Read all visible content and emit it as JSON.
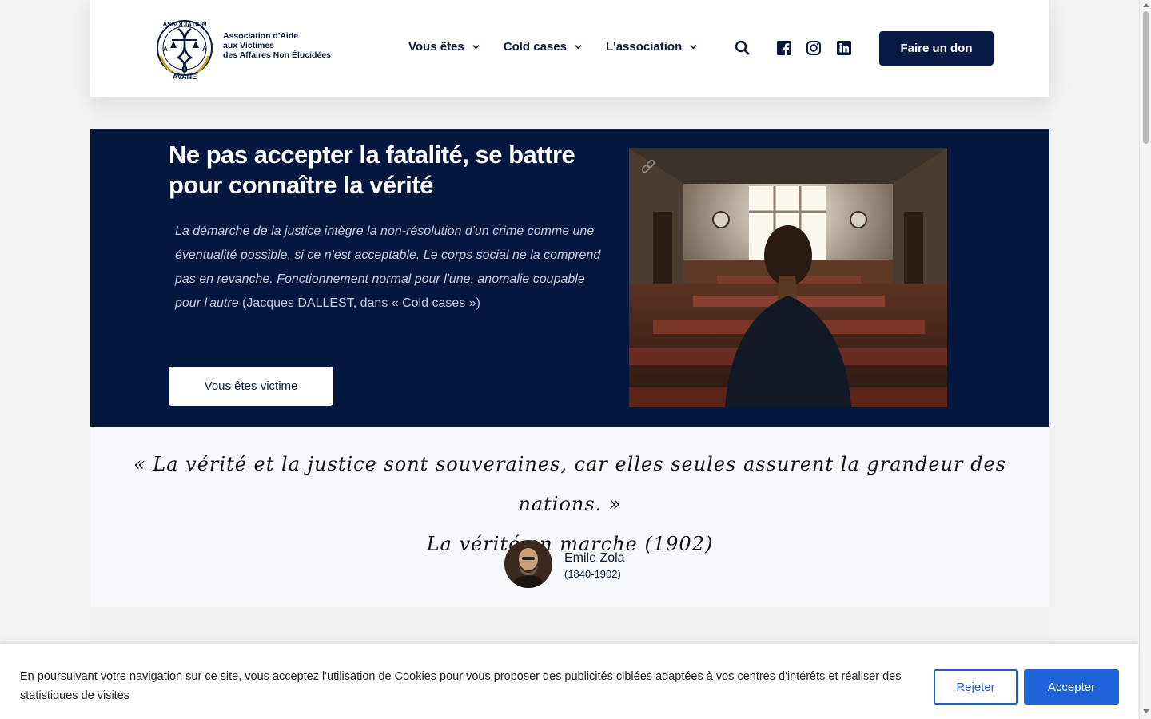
{
  "header": {
    "logo_ring_text": "ASSOCIATION",
    "logo_bottom_text": "AVANE",
    "logo_side_letter": "A",
    "logo_text_lines": [
      "Association d'Aide",
      "aux Victimes",
      "des Affaires Non Élucidées"
    ],
    "nav": [
      {
        "label": "Vous êtes",
        "icon": "chevron-down-icon"
      },
      {
        "label": "Cold cases",
        "icon": "chevron-down-icon"
      },
      {
        "label": "L'association",
        "icon": "chevron-down-icon"
      }
    ],
    "icons": [
      "search-icon",
      "facebook-icon",
      "instagram-icon",
      "linkedin-icon"
    ],
    "donate_label": "Faire un don"
  },
  "hero": {
    "title": "Ne pas accepter la fatalité, se battre pour connaître la vérité",
    "quote_italic": "La démarche de la justice intègre la non-résolution d'un crime comme une éventualité possible, si ce n'est acceptable. Le corps social ne la comprend pas en revanche. Fonctionnement normal pour l'une, anomalie coupable pour l'autre",
    "quote_source": " (Jacques DALLEST, dans « Cold cases »)",
    "cta_label": "Vous êtes victime",
    "image_icon": "link-icon"
  },
  "quote_section": {
    "quote_line1": "« La vérité et la justice sont souveraines, car elles seules assurent la grandeur des nations. »",
    "quote_line2": "La vérité en marche (1902)",
    "author_name": "Emile Zola",
    "author_years": "(1840-1902)"
  },
  "cookie_banner": {
    "text": "En poursuivant votre navigation sur ce site, vous acceptez l'utilisation de Cookies pour vous proposer des publicités ciblées adaptées à vos centres d'intérêts et réaliser des statistiques de visites",
    "reject_label": "Rejeter",
    "accept_label": "Accepter"
  },
  "colors": {
    "navy": "#04173f",
    "accent_blue": "#1f63d8",
    "gold": "#c9a227"
  }
}
